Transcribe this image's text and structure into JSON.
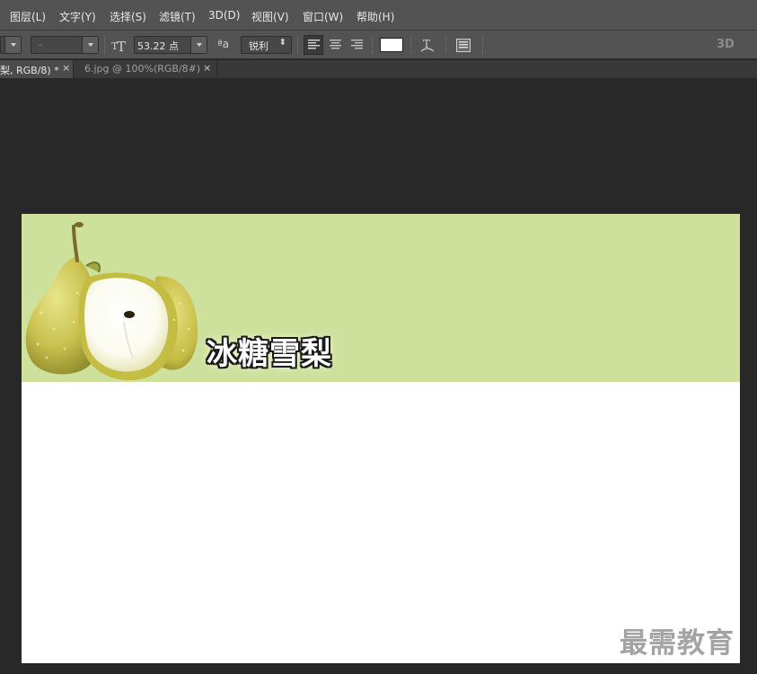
{
  "menu": {
    "items": [
      {
        "label": "图层(L)"
      },
      {
        "label": "文字(Y)"
      },
      {
        "label": "选择(S)"
      },
      {
        "label": "滤镜(T)"
      },
      {
        "label": "3D(D)"
      },
      {
        "label": "视图(V)"
      },
      {
        "label": "窗口(W)"
      },
      {
        "label": "帮助(H)"
      }
    ]
  },
  "options": {
    "font_style_value": "-",
    "font_size_icon": "font-size-icon",
    "font_size_value": "53.22 点",
    "antialias_icon": "antialias-icon",
    "antialias_icon_text": "ªa",
    "antialias_value": "锐利",
    "align_left_icon": "align-left-icon",
    "align_center_icon": "align-center-icon",
    "align_right_icon": "align-right-icon",
    "text_color": "#ffffff",
    "warp_text_icon": "warp-text-icon",
    "char_panel_icon": "character-panel-icon",
    "three_d_label": "3D"
  },
  "tabs": [
    {
      "label": "梨, RGB/8) *",
      "close": "×",
      "active": true
    },
    {
      "label": "6.jpg @ 100%(RGB/8#)",
      "close": "×",
      "active": false
    }
  ],
  "canvas": {
    "banner_color": "#cde09c",
    "banner_title": "冰糖雪梨"
  },
  "watermark": "最需教育"
}
